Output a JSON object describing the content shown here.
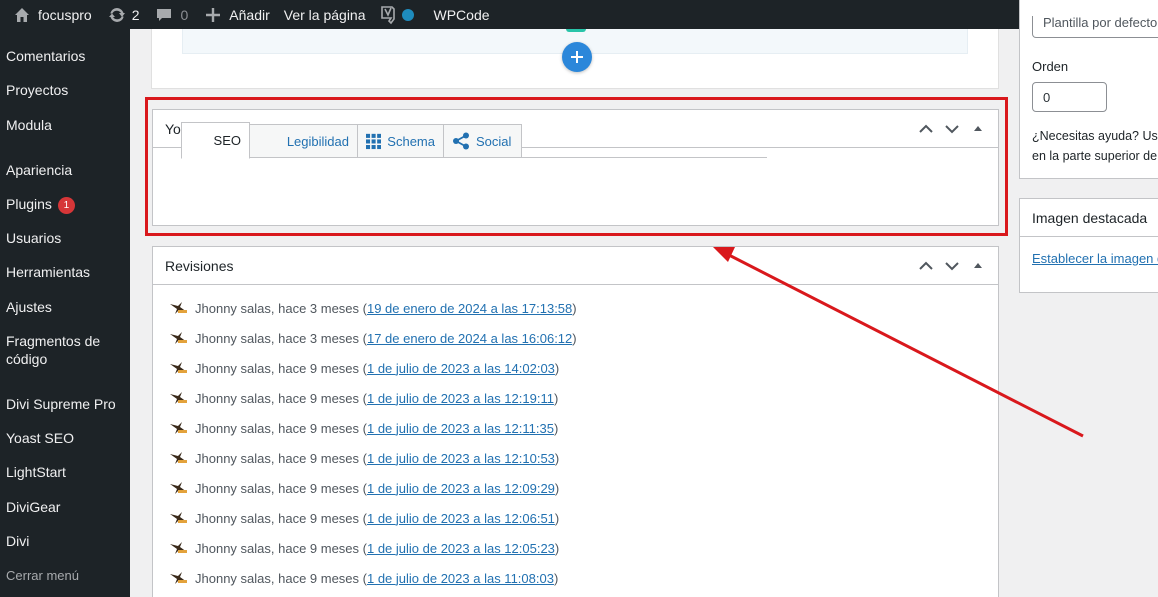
{
  "admin_bar": {
    "site_name": "focuspro",
    "updates_count": "2",
    "comments_count": "0",
    "add_new": "Añadir",
    "view_page": "Ver la página",
    "wpcode": "WPCode"
  },
  "sidebar": {
    "items": [
      {
        "label": "Comentarios"
      },
      {
        "label": "Proyectos"
      },
      {
        "label": "Modula"
      },
      {
        "label": "Apariencia"
      },
      {
        "label": "Plugins",
        "badge": "1"
      },
      {
        "label": "Usuarios"
      },
      {
        "label": "Herramientas"
      },
      {
        "label": "Ajustes"
      },
      {
        "label": "Fragmentos de código"
      },
      {
        "label": "Divi Supreme Pro"
      },
      {
        "label": "Yoast SEO"
      },
      {
        "label": "LightStart"
      },
      {
        "label": "DiviGear"
      },
      {
        "label": "Divi"
      }
    ],
    "collapse": "Cerrar menú"
  },
  "yoast": {
    "title": "Yoast SEO",
    "tabs": [
      "SEO",
      "Legibilidad",
      "Schema",
      "Social"
    ]
  },
  "revisions": {
    "title": "Revisiones",
    "items": [
      {
        "author": "Jhonny salas, hace 3 meses (",
        "link": "19 de enero de 2024 a las 17:13:58",
        "close": ")"
      },
      {
        "author": "Jhonny salas, hace 3 meses (",
        "link": "17 de enero de 2024 a las 16:06:12",
        "close": ")"
      },
      {
        "author": "Jhonny salas, hace 9 meses (",
        "link": "1 de julio de 2023 a las 14:02:03",
        "close": ")"
      },
      {
        "author": "Jhonny salas, hace 9 meses (",
        "link": "1 de julio de 2023 a las 12:19:11",
        "close": ")"
      },
      {
        "author": "Jhonny salas, hace 9 meses (",
        "link": "1 de julio de 2023 a las 12:11:35",
        "close": ")"
      },
      {
        "author": "Jhonny salas, hace 9 meses (",
        "link": "1 de julio de 2023 a las 12:10:53",
        "close": ")"
      },
      {
        "author": "Jhonny salas, hace 9 meses (",
        "link": "1 de julio de 2023 a las 12:09:29",
        "close": ")"
      },
      {
        "author": "Jhonny salas, hace 9 meses (",
        "link": "1 de julio de 2023 a las 12:06:51",
        "close": ")"
      },
      {
        "author": "Jhonny salas, hace 9 meses (",
        "link": "1 de julio de 2023 a las 12:05:23",
        "close": ")"
      },
      {
        "author": "Jhonny salas, hace 9 meses (",
        "link": "1 de julio de 2023 a las 11:08:03",
        "close": ")"
      }
    ]
  },
  "right": {
    "template_value": "Plantilla por defecto",
    "order_label": "Orden",
    "order_value": "0",
    "help_line1": "¿Necesitas ayuda? Usa",
    "help_line2": "en la parte superior de",
    "featured_title": "Imagen destacada",
    "featured_link": "Establecer la imagen d"
  },
  "colors": {
    "highlight": "#d9181c",
    "link": "#2271b1",
    "admin_bar": "#1d2327"
  },
  "icons": [
    "wordpress-home-icon",
    "update-icon",
    "comment-icon",
    "plus-icon",
    "yoast-icon",
    "schema-grid-icon",
    "share-icon",
    "chevron-up-icon",
    "chevron-down-icon",
    "collapse-arrow-icon"
  ]
}
